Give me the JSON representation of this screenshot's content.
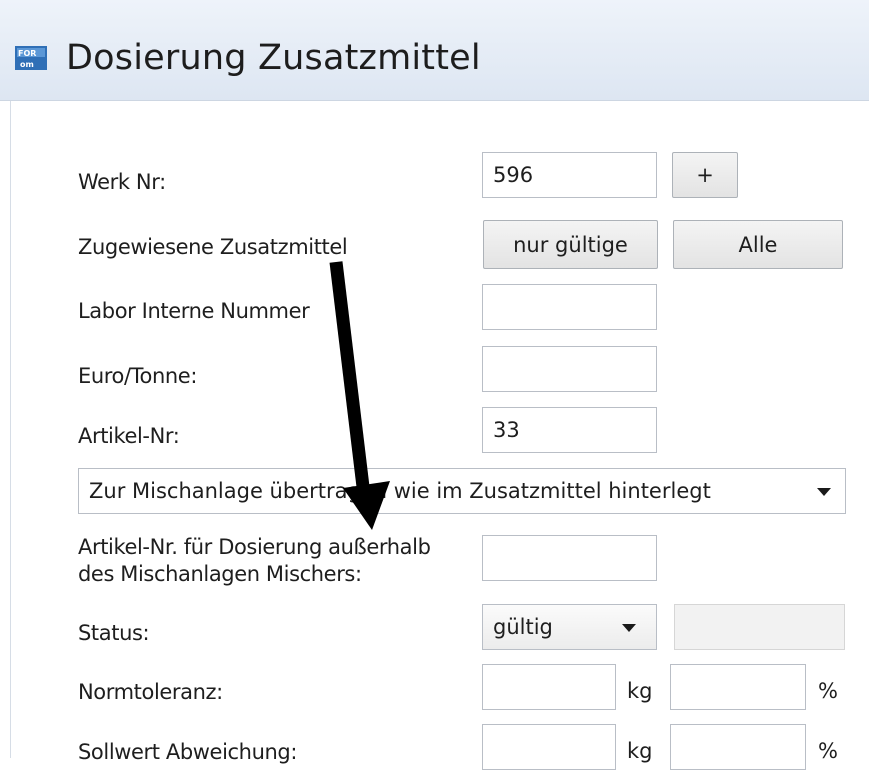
{
  "window": {
    "title": "Dosierung Zusatzmittel",
    "icon": "app-logo-icon"
  },
  "form": {
    "werk_nr": {
      "label": "Werk Nr:",
      "value": "596",
      "add_button": "+"
    },
    "zugewiesene": {
      "label": "Zugewiesene Zusatzmittel",
      "btn_gueltige": "nur gültige",
      "btn_alle": "Alle"
    },
    "labor_nummer": {
      "label": "Labor Interne Nummer",
      "value": ""
    },
    "euro_tonne": {
      "label": "Euro/Tonne:",
      "value": ""
    },
    "artikel_nr": {
      "label": "Artikel-Nr:",
      "value": "33"
    },
    "mischanlage": {
      "selected": "Zur Mischanlage übertragen wie im Zusatzmittel hinterlegt"
    },
    "artikel_ausserhalb": {
      "label_line1": "Artikel-Nr. für Dosierung außerhalb",
      "label_line2": "des Mischanlagen Mischers:",
      "value": ""
    },
    "status": {
      "label": "Status:",
      "selected": "gültig",
      "extra_value": ""
    },
    "normtoleranz": {
      "label": "Normtoleranz:",
      "kg_value": "",
      "kg_unit": "kg",
      "pct_value": "",
      "pct_unit": "%"
    },
    "sollwert": {
      "label": "Sollwert Abweichung:",
      "kg_value": "",
      "kg_unit": "kg",
      "pct_value": "",
      "pct_unit": "%"
    }
  },
  "annotation": {
    "arrow_color": "#000000"
  }
}
